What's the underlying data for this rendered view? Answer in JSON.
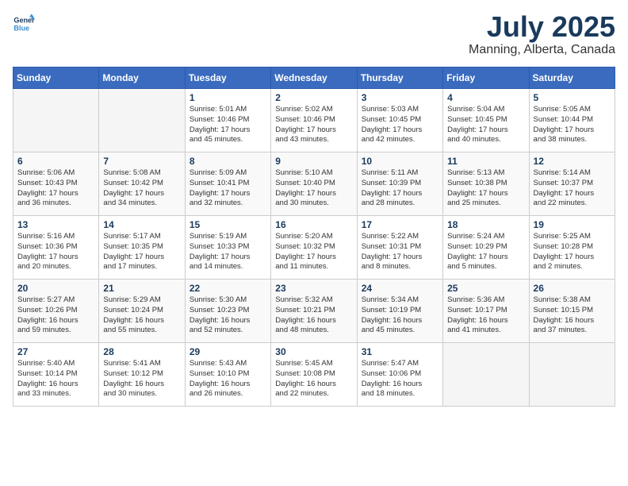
{
  "header": {
    "logo_line1": "General",
    "logo_line2": "Blue",
    "month": "July 2025",
    "location": "Manning, Alberta, Canada"
  },
  "days_of_week": [
    "Sunday",
    "Monday",
    "Tuesday",
    "Wednesday",
    "Thursday",
    "Friday",
    "Saturday"
  ],
  "weeks": [
    [
      {
        "day": "",
        "info": ""
      },
      {
        "day": "",
        "info": ""
      },
      {
        "day": "1",
        "info": "Sunrise: 5:01 AM\nSunset: 10:46 PM\nDaylight: 17 hours\nand 45 minutes."
      },
      {
        "day": "2",
        "info": "Sunrise: 5:02 AM\nSunset: 10:46 PM\nDaylight: 17 hours\nand 43 minutes."
      },
      {
        "day": "3",
        "info": "Sunrise: 5:03 AM\nSunset: 10:45 PM\nDaylight: 17 hours\nand 42 minutes."
      },
      {
        "day": "4",
        "info": "Sunrise: 5:04 AM\nSunset: 10:45 PM\nDaylight: 17 hours\nand 40 minutes."
      },
      {
        "day": "5",
        "info": "Sunrise: 5:05 AM\nSunset: 10:44 PM\nDaylight: 17 hours\nand 38 minutes."
      }
    ],
    [
      {
        "day": "6",
        "info": "Sunrise: 5:06 AM\nSunset: 10:43 PM\nDaylight: 17 hours\nand 36 minutes."
      },
      {
        "day": "7",
        "info": "Sunrise: 5:08 AM\nSunset: 10:42 PM\nDaylight: 17 hours\nand 34 minutes."
      },
      {
        "day": "8",
        "info": "Sunrise: 5:09 AM\nSunset: 10:41 PM\nDaylight: 17 hours\nand 32 minutes."
      },
      {
        "day": "9",
        "info": "Sunrise: 5:10 AM\nSunset: 10:40 PM\nDaylight: 17 hours\nand 30 minutes."
      },
      {
        "day": "10",
        "info": "Sunrise: 5:11 AM\nSunset: 10:39 PM\nDaylight: 17 hours\nand 28 minutes."
      },
      {
        "day": "11",
        "info": "Sunrise: 5:13 AM\nSunset: 10:38 PM\nDaylight: 17 hours\nand 25 minutes."
      },
      {
        "day": "12",
        "info": "Sunrise: 5:14 AM\nSunset: 10:37 PM\nDaylight: 17 hours\nand 22 minutes."
      }
    ],
    [
      {
        "day": "13",
        "info": "Sunrise: 5:16 AM\nSunset: 10:36 PM\nDaylight: 17 hours\nand 20 minutes."
      },
      {
        "day": "14",
        "info": "Sunrise: 5:17 AM\nSunset: 10:35 PM\nDaylight: 17 hours\nand 17 minutes."
      },
      {
        "day": "15",
        "info": "Sunrise: 5:19 AM\nSunset: 10:33 PM\nDaylight: 17 hours\nand 14 minutes."
      },
      {
        "day": "16",
        "info": "Sunrise: 5:20 AM\nSunset: 10:32 PM\nDaylight: 17 hours\nand 11 minutes."
      },
      {
        "day": "17",
        "info": "Sunrise: 5:22 AM\nSunset: 10:31 PM\nDaylight: 17 hours\nand 8 minutes."
      },
      {
        "day": "18",
        "info": "Sunrise: 5:24 AM\nSunset: 10:29 PM\nDaylight: 17 hours\nand 5 minutes."
      },
      {
        "day": "19",
        "info": "Sunrise: 5:25 AM\nSunset: 10:28 PM\nDaylight: 17 hours\nand 2 minutes."
      }
    ],
    [
      {
        "day": "20",
        "info": "Sunrise: 5:27 AM\nSunset: 10:26 PM\nDaylight: 16 hours\nand 59 minutes."
      },
      {
        "day": "21",
        "info": "Sunrise: 5:29 AM\nSunset: 10:24 PM\nDaylight: 16 hours\nand 55 minutes."
      },
      {
        "day": "22",
        "info": "Sunrise: 5:30 AM\nSunset: 10:23 PM\nDaylight: 16 hours\nand 52 minutes."
      },
      {
        "day": "23",
        "info": "Sunrise: 5:32 AM\nSunset: 10:21 PM\nDaylight: 16 hours\nand 48 minutes."
      },
      {
        "day": "24",
        "info": "Sunrise: 5:34 AM\nSunset: 10:19 PM\nDaylight: 16 hours\nand 45 minutes."
      },
      {
        "day": "25",
        "info": "Sunrise: 5:36 AM\nSunset: 10:17 PM\nDaylight: 16 hours\nand 41 minutes."
      },
      {
        "day": "26",
        "info": "Sunrise: 5:38 AM\nSunset: 10:15 PM\nDaylight: 16 hours\nand 37 minutes."
      }
    ],
    [
      {
        "day": "27",
        "info": "Sunrise: 5:40 AM\nSunset: 10:14 PM\nDaylight: 16 hours\nand 33 minutes."
      },
      {
        "day": "28",
        "info": "Sunrise: 5:41 AM\nSunset: 10:12 PM\nDaylight: 16 hours\nand 30 minutes."
      },
      {
        "day": "29",
        "info": "Sunrise: 5:43 AM\nSunset: 10:10 PM\nDaylight: 16 hours\nand 26 minutes."
      },
      {
        "day": "30",
        "info": "Sunrise: 5:45 AM\nSunset: 10:08 PM\nDaylight: 16 hours\nand 22 minutes."
      },
      {
        "day": "31",
        "info": "Sunrise: 5:47 AM\nSunset: 10:06 PM\nDaylight: 16 hours\nand 18 minutes."
      },
      {
        "day": "",
        "info": ""
      },
      {
        "day": "",
        "info": ""
      }
    ]
  ]
}
